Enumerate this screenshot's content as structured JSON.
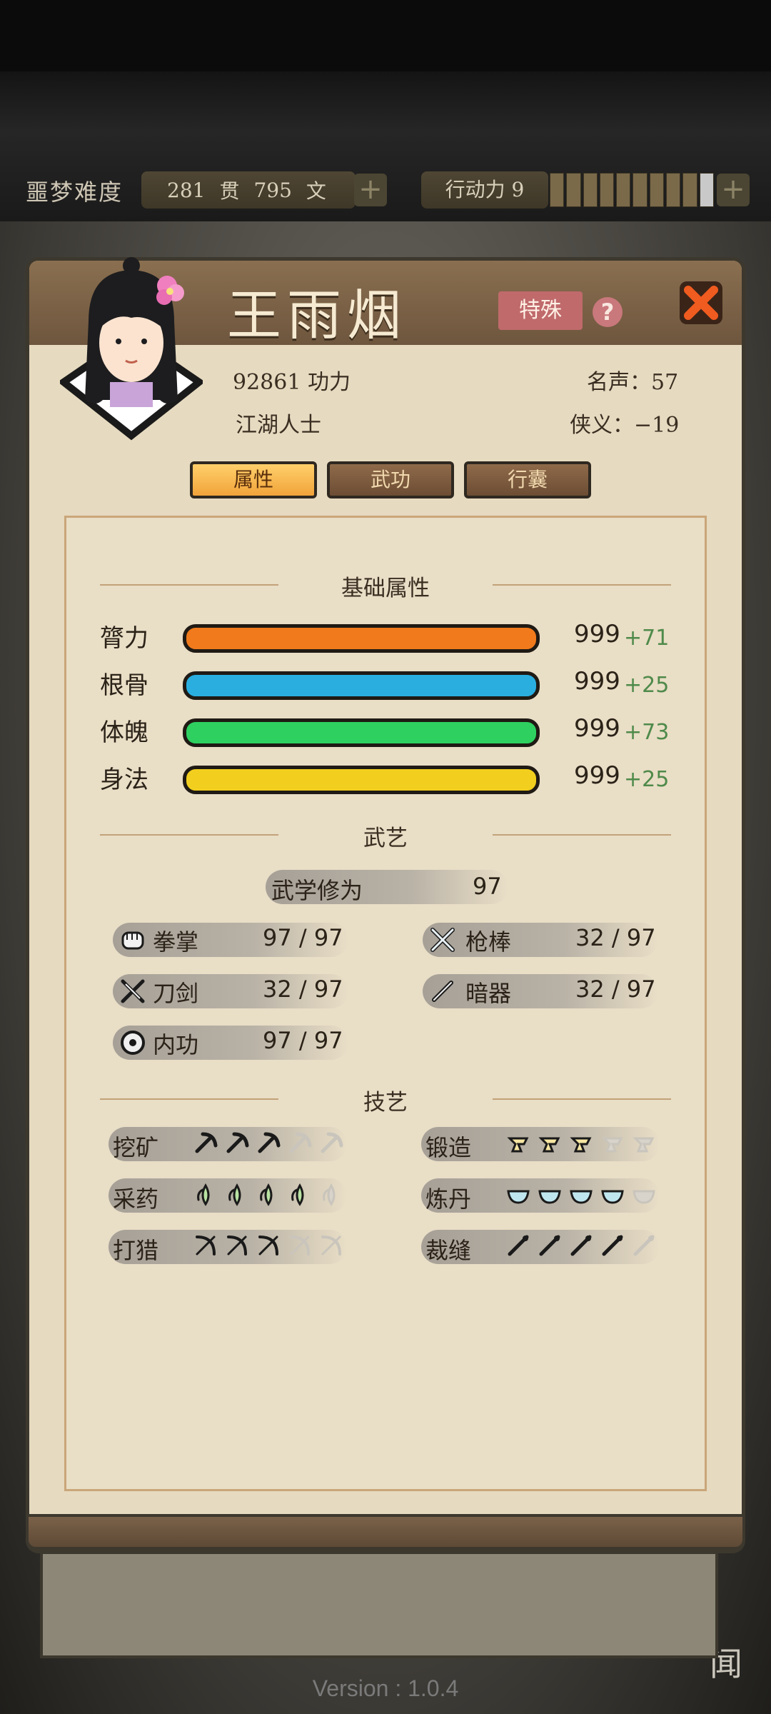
{
  "topbar": {
    "difficulty": "噩梦难度",
    "money_guan": "281",
    "guan_unit": "贯",
    "money_wen": "795",
    "wen_unit": "文",
    "stamina_label": "行动力 9",
    "stamina_value": 9,
    "stamina_max": 10
  },
  "character": {
    "name": "王雨烟",
    "special_label": "特殊",
    "help_label": "?",
    "power": "92861 功力",
    "fame": "名声：57",
    "identity": "江湖人士",
    "chivalry": "侠义：−19"
  },
  "tabs": [
    {
      "label": "属性",
      "active": true
    },
    {
      "label": "武功",
      "active": false
    },
    {
      "label": "行囊",
      "active": false
    }
  ],
  "basic_attributes": {
    "title": "基础属性",
    "items": [
      {
        "label": "膂力",
        "value": "999",
        "bonus": "+71",
        "color": "#f07a1c"
      },
      {
        "label": "根骨",
        "value": "999",
        "bonus": "+25",
        "color": "#2aaee0"
      },
      {
        "label": "体魄",
        "value": "999",
        "bonus": "+73",
        "color": "#2ed160"
      },
      {
        "label": "身法",
        "value": "999",
        "bonus": "+25",
        "color": "#f2cf1e"
      }
    ]
  },
  "martial": {
    "title": "武艺",
    "cultivation_label": "武学修为",
    "cultivation_value": "97",
    "skills": [
      {
        "label": "拳掌",
        "value": "97 / 97",
        "icon": "fist-icon"
      },
      {
        "label": "枪棒",
        "value": "32 / 97",
        "icon": "spear-icon"
      },
      {
        "label": "刀剑",
        "value": "32 / 97",
        "icon": "swords-icon"
      },
      {
        "label": "暗器",
        "value": "32 / 97",
        "icon": "dart-icon"
      },
      {
        "label": "内功",
        "value": "97 / 97",
        "icon": "inner-energy-icon"
      }
    ]
  },
  "crafts": {
    "title": "技艺",
    "items": [
      {
        "label": "挖矿",
        "level": 3,
        "max": 5,
        "icon": "pickaxe-icon"
      },
      {
        "label": "锻造",
        "level": 3,
        "max": 5,
        "icon": "anvil-icon"
      },
      {
        "label": "采药",
        "level": 4,
        "max": 5,
        "icon": "herb-icon"
      },
      {
        "label": "炼丹",
        "level": 4,
        "max": 5,
        "icon": "mortar-icon"
      },
      {
        "label": "打猎",
        "level": 3,
        "max": 5,
        "icon": "bow-icon"
      },
      {
        "label": "裁缝",
        "level": 4,
        "max": 5,
        "icon": "needle-icon"
      }
    ]
  },
  "scene_label": "闻",
  "version": "Version : 1.0.4"
}
